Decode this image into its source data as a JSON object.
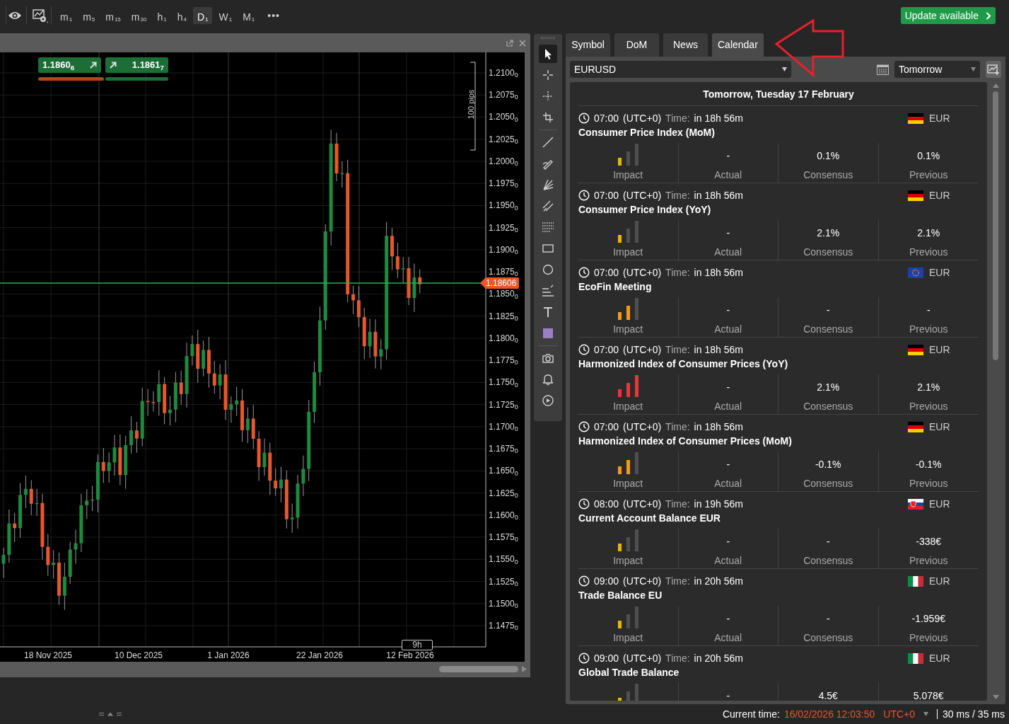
{
  "toolbar": {
    "timeframes": [
      {
        "label": "m",
        "sub": "1",
        "selected": false
      },
      {
        "label": "m",
        "sub": "5",
        "selected": false
      },
      {
        "label": "m",
        "sub": "15",
        "selected": false
      },
      {
        "label": "m",
        "sub": "30",
        "selected": false
      },
      {
        "label": "h",
        "sub": "1",
        "selected": false
      },
      {
        "label": "h",
        "sub": "4",
        "selected": false
      },
      {
        "label": "D",
        "sub": "1",
        "selected": true
      },
      {
        "label": "W",
        "sub": "1",
        "selected": false
      },
      {
        "label": "M",
        "sub": "1",
        "selected": false
      }
    ],
    "more": "•••",
    "update_button": "Update available"
  },
  "chart": {
    "sell_price": "1.1860$_{6}$",
    "buy_price": "1.1861$_{7}$",
    "range_label": "100 pips",
    "current_price": "1.18606",
    "countdown": "9h",
    "y_axis_labels": [
      "1.2100$_{0}$",
      "1.2075$_{0}$",
      "1.2050$_{0}$",
      "1.2025$_{0}$",
      "1.2000$_{0}$",
      "1.1975$_{0}$",
      "1.1950$_{0}$",
      "1.1925$_{0}$",
      "1.1900$_{0}$",
      "1.1875$_{0}$",
      "1.1850$_{0}$",
      "1.1825$_{0}$",
      "1.1800$_{0}$",
      "1.1775$_{0}$",
      "1.1750$_{0}$",
      "1.1725$_{0}$",
      "1.1700$_{0}$",
      "1.1675$_{0}$",
      "1.1650$_{0}$",
      "1.1625$_{0}$",
      "1.1600$_{0}$",
      "1.1575$_{0}$",
      "1.1550$_{0}$",
      "1.1525$_{0}$",
      "1.1500$_{0}$",
      "1.1475$_{0}$"
    ],
    "x_axis_labels": [
      "18 Nov 2025",
      "10 Dec 2025",
      "1 Jan 2026",
      "22 Jan 2026",
      "12 Feb 2026"
    ]
  },
  "tool_groups": [
    [
      {
        "kind": "pointer",
        "selected": true
      },
      {
        "kind": "crosshair",
        "selected": false
      },
      {
        "kind": "crosshair-dotted",
        "selected": false
      },
      {
        "kind": "measure",
        "selected": false
      }
    ],
    [
      {
        "kind": "line",
        "selected": false
      },
      {
        "kind": "pen",
        "selected": false
      },
      {
        "kind": "fan",
        "selected": false
      },
      {
        "kind": "channel",
        "selected": false
      },
      {
        "kind": "dotted-grid",
        "selected": false
      },
      {
        "kind": "rectangle",
        "selected": false
      },
      {
        "kind": "circle",
        "selected": false
      },
      {
        "kind": "levels",
        "selected": false
      },
      {
        "kind": "text",
        "selected": false
      },
      {
        "kind": "color",
        "selected": false
      }
    ],
    [
      {
        "kind": "camera",
        "selected": false
      },
      {
        "kind": "bell",
        "selected": false
      },
      {
        "kind": "replay",
        "selected": false
      }
    ]
  ],
  "tabs": [
    {
      "label": "Symbol",
      "selected": false
    },
    {
      "label": "DoM",
      "selected": false
    },
    {
      "label": "News",
      "selected": false
    },
    {
      "label": "Calendar",
      "selected": true
    }
  ],
  "calendar": {
    "symbol": "EURUSD",
    "period": "Tomorrow",
    "heading": "Tomorrow, Tuesday 17 February",
    "events": [
      {
        "time": "07:00",
        "timezone": "(UTC+0)",
        "time_label": "Time:",
        "countdown": "in 18h 56m",
        "flag": {
          "kind": "de"
        },
        "currency": "EUR",
        "title": "Consumer Price Index (MoM)",
        "impact": {
          "kind": "low"
        },
        "impact_label": "Impact",
        "actual": "-",
        "actual_label": "Actual",
        "consensus": "0.1%",
        "consensus_label": "Consensus",
        "previous": "0.1%",
        "previous_label": "Previous"
      },
      {
        "time": "07:00",
        "timezone": "(UTC+0)",
        "time_label": "Time:",
        "countdown": "in 18h 56m",
        "flag": {
          "kind": "de"
        },
        "currency": "EUR",
        "title": "Consumer Price Index (YoY)",
        "impact": {
          "kind": "low"
        },
        "impact_label": "Impact",
        "actual": "-",
        "actual_label": "Actual",
        "consensus": "2.1%",
        "consensus_label": "Consensus",
        "previous": "2.1%",
        "previous_label": "Previous"
      },
      {
        "time": "07:00",
        "timezone": "(UTC+0)",
        "time_label": "Time:",
        "countdown": "in 18h 56m",
        "flag": {
          "kind": "eu"
        },
        "currency": "EUR",
        "title": "EcoFin Meeting",
        "impact": {
          "kind": "medium"
        },
        "impact_label": "Impact",
        "actual": "-",
        "actual_label": "Actual",
        "consensus": "-",
        "consensus_label": "Consensus",
        "previous": "-",
        "previous_label": "Previous"
      },
      {
        "time": "07:00",
        "timezone": "(UTC+0)",
        "time_label": "Time:",
        "countdown": "in 18h 56m",
        "flag": {
          "kind": "de"
        },
        "currency": "EUR",
        "title": "Harmonized Index of Consumer Prices (YoY)",
        "impact": {
          "kind": "high"
        },
        "impact_label": "Impact",
        "actual": "-",
        "actual_label": "Actual",
        "consensus": "2.1%",
        "consensus_label": "Consensus",
        "previous": "2.1%",
        "previous_label": "Previous"
      },
      {
        "time": "07:00",
        "timezone": "(UTC+0)",
        "time_label": "Time:",
        "countdown": "in 18h 56m",
        "flag": {
          "kind": "de"
        },
        "currency": "EUR",
        "title": "Harmonized Index of Consumer Prices (MoM)",
        "impact": {
          "kind": "medium"
        },
        "impact_label": "Impact",
        "actual": "-",
        "actual_label": "Actual",
        "consensus": "-0.1%",
        "consensus_label": "Consensus",
        "previous": "-0.1%",
        "previous_label": "Previous"
      },
      {
        "time": "08:00",
        "timezone": "(UTC+0)",
        "time_label": "Time:",
        "countdown": "in 19h 56m",
        "flag": {
          "kind": "sk"
        },
        "currency": "EUR",
        "title": "Current Account Balance EUR",
        "impact": {
          "kind": "low"
        },
        "impact_label": "Impact",
        "actual": "-",
        "actual_label": "Actual",
        "consensus": "-",
        "consensus_label": "Consensus",
        "previous": "-338€",
        "previous_label": "Previous"
      },
      {
        "time": "09:00",
        "timezone": "(UTC+0)",
        "time_label": "Time:",
        "countdown": "in 20h 56m",
        "flag": {
          "kind": "it"
        },
        "currency": "EUR",
        "title": "Trade Balance EU",
        "impact": {
          "kind": "low"
        },
        "impact_label": "Impact",
        "actual": "-",
        "actual_label": "Actual",
        "consensus": "-",
        "consensus_label": "Consensus",
        "previous": "-1.959€",
        "previous_label": "Previous"
      },
      {
        "time": "09:00",
        "timezone": "(UTC+0)",
        "time_label": "Time:",
        "countdown": "in 20h 56m",
        "flag": {
          "kind": "it"
        },
        "currency": "EUR",
        "title": "Global Trade Balance",
        "impact": {
          "kind": "low"
        },
        "actual": "-",
        "consensus": "4.5€",
        "previous": "5.078€"
      }
    ]
  },
  "status": {
    "label": "Current time:",
    "datetime": "16/02/2026 12:03:50",
    "timezone": "UTC+0",
    "latency": "30 ms / 35 ms"
  }
}
